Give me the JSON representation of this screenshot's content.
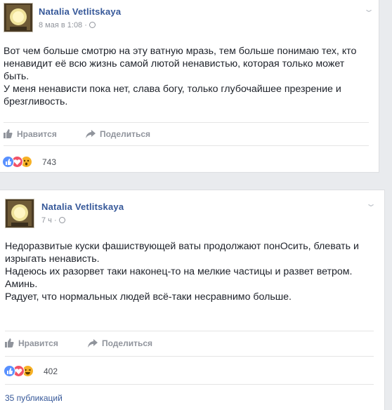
{
  "posts": [
    {
      "author": "Natalia Vetlitskaya",
      "timestamp": "8 мая в 1:08 ·",
      "paragraphs": [
        "Вот чем больше смотрю на эту ватную мразь, тем больше понимаю тех, кто ненавидит её всю жизнь самой лютой ненавистью, которая только может быть.",
        "У меня ненависти пока нет, слава богу, только глубочайшее презрение и брезгливость."
      ],
      "like_label": "Нравится",
      "share_label": "Поделиться",
      "reaction_icons": [
        "like-icon",
        "love-icon",
        "wow-icon"
      ],
      "reaction_count": "743"
    },
    {
      "author": "Natalia Vetlitskaya",
      "timestamp": "7 ч ·",
      "paragraphs": [
        "Недоразвитые куски фашиствующей ваты продолжают понОсить, блевать и изрыгать ненависть.",
        "Надеюсь их разорвет таки наконец-то на мелкие частицы и развет ветром.",
        "Аминь.",
        "Радует, что нормальных людей всё-таки несравнимо больше."
      ],
      "like_label": "Нравится",
      "share_label": "Поделиться",
      "reaction_icons": [
        "like-icon",
        "love-icon",
        "haha-icon"
      ],
      "reaction_count": "402",
      "shares_link": "35 публикаций"
    }
  ],
  "colors": {
    "link": "#365899",
    "meta": "#90949c",
    "like": "#5890ff",
    "love": "#f25268",
    "wow": "#f7b125"
  }
}
